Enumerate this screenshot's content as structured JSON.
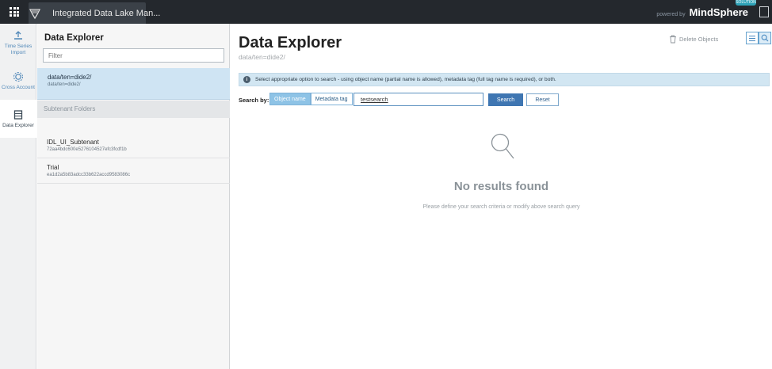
{
  "topbar": {
    "app_title": "Integrated Data Lake Man...",
    "powered_by": "powered by",
    "brand": "MindSphere",
    "brand_badge": "SOLUTION"
  },
  "rail": {
    "items": [
      {
        "label": "Time Series Import",
        "icon": "upload-icon"
      },
      {
        "label": "Cross Account",
        "icon": "gear-network-icon"
      },
      {
        "label": "Data Explorer",
        "icon": "database-icon"
      }
    ]
  },
  "panel": {
    "title": "Data Explorer",
    "filter_placeholder": "Filter",
    "current_folder": {
      "name": "data/ten=dide2/",
      "path": "data/ten=dide2/"
    },
    "subtenant_header": "Subtenant Folders",
    "folders": [
      {
        "name": "IDL_UI_Subtenant",
        "id": "72aa4bdc600e5276104527efc3fcdf1b"
      },
      {
        "name": "Trial",
        "id": "ea1d2a5b83adcc33b622accd9583086c"
      }
    ]
  },
  "main": {
    "title": "Data Explorer",
    "path": "data/ten=dide2/",
    "delete_label": "Delete Objects",
    "info_text": "Select appropriate option to search - using object name (partial name is allowed), metadata tag (full tag name is required), or both.",
    "search_by_label": "Search by:",
    "segments": [
      "Object name",
      "Metadata tag"
    ],
    "search_value": "testsearch",
    "search_button": "Search",
    "reset_button": "Reset",
    "empty_title": "No results found",
    "empty_subtitle": "Please define your search criteria or modify above search query"
  },
  "colors": {
    "topbar": "#24282d",
    "accent": "#3f76b2",
    "selected_folder": "#cfe4f3",
    "info_bar": "#d2e6f2"
  }
}
